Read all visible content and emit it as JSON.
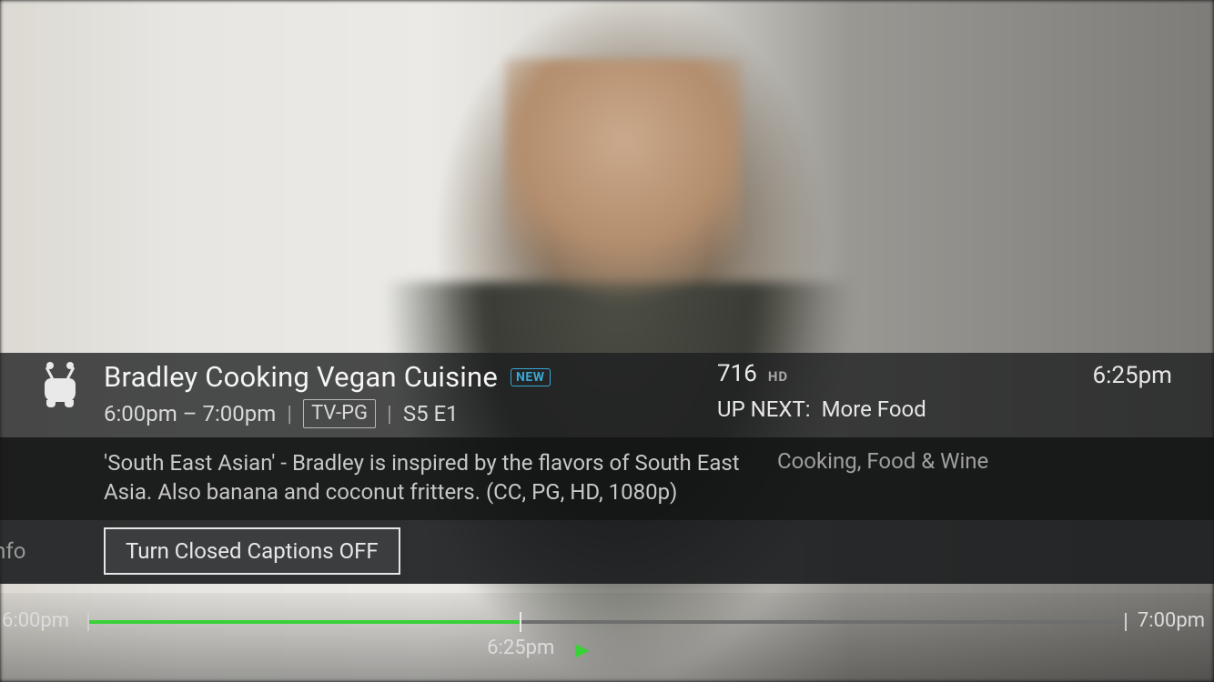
{
  "program": {
    "title": "Bradley Cooking Vegan Cuisine",
    "new_badge": "NEW",
    "time_range": "6:00pm – 7:00pm",
    "rating": "TV-PG",
    "episode": "S5 E1",
    "description": "'South East Asian' - Bradley is inspired by the flavors of South East Asia. Also banana and coconut fritters. (CC, PG, HD, 1080p)",
    "category": "Cooking, Food & Wine"
  },
  "channel": {
    "number": "716",
    "hd": "HD"
  },
  "clock": "6:25pm",
  "up_next": {
    "label": "UP NEXT:",
    "title": "More Food"
  },
  "actions": {
    "more_info": "re Info",
    "closed_captions": "Turn Closed Captions OFF"
  },
  "timeline": {
    "start": "6:00pm",
    "end": "7:00pm",
    "now_label": "6:25pm",
    "progress_percent": 41.7
  }
}
